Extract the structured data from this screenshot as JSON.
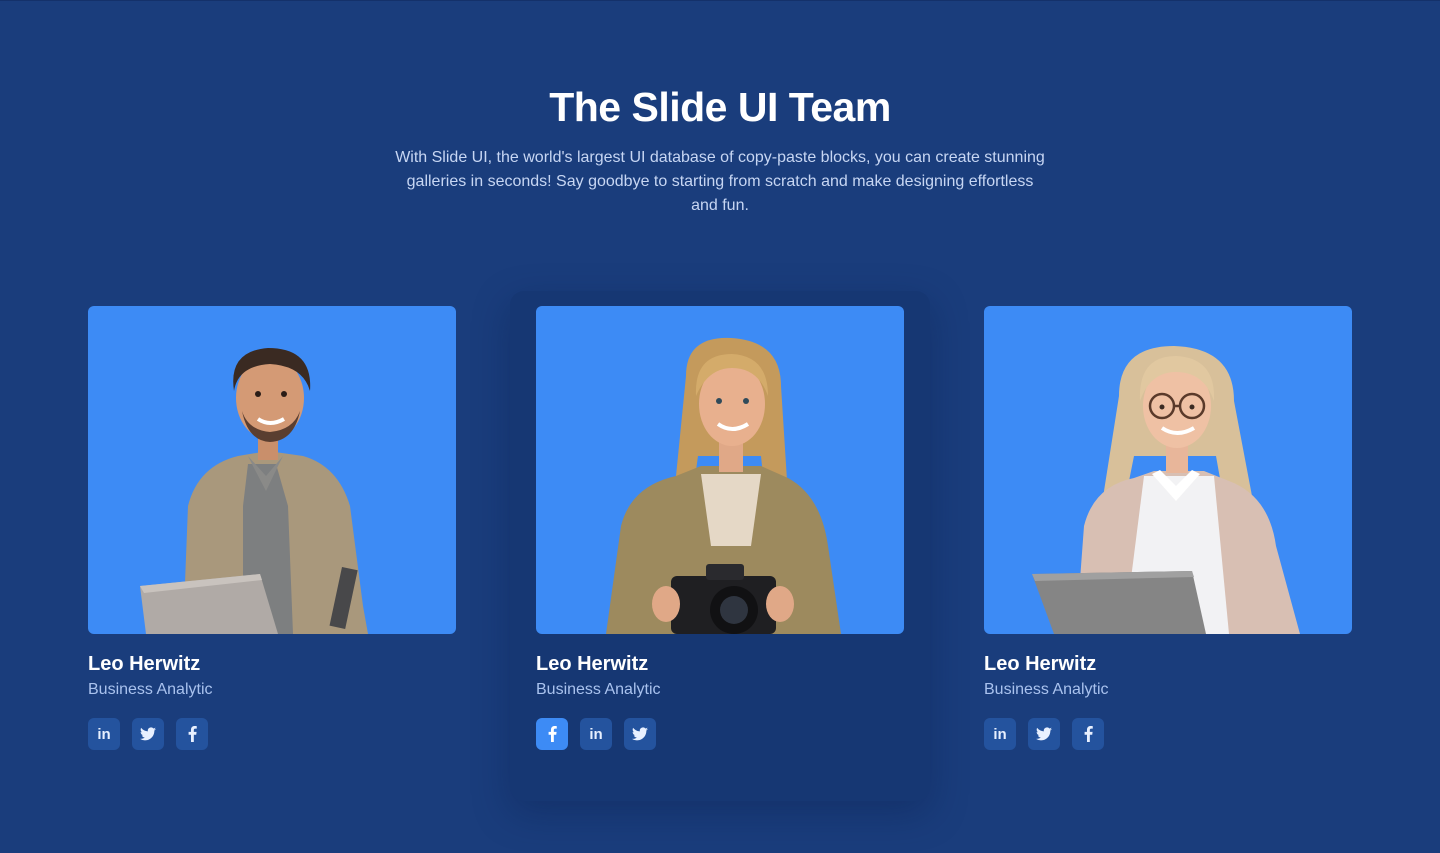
{
  "section": {
    "title": "The Slide UI Team",
    "description": "With Slide UI, the world's largest UI database of copy-paste blocks, you can create stunning galleries in seconds! Say goodbye to starting from scratch and make designing effortless and fun."
  },
  "colors": {
    "background": "#1a3d7c",
    "photo_background": "#3d8bf5",
    "social_button": "#24539e",
    "social_button_active": "#3d8bf5"
  },
  "team": [
    {
      "name": "Leo Herwitz",
      "role": "Business Analytic",
      "photo": "man-with-laptop",
      "socials": [
        {
          "icon": "linkedin-icon",
          "label": "in",
          "active": false
        },
        {
          "icon": "twitter-icon",
          "label": "",
          "active": false
        },
        {
          "icon": "facebook-icon",
          "label": "",
          "active": false
        }
      ]
    },
    {
      "name": "Leo Herwitz",
      "role": "Business Analytic",
      "photo": "woman-with-camera",
      "socials": [
        {
          "icon": "facebook-icon",
          "label": "",
          "active": true
        },
        {
          "icon": "linkedin-icon",
          "label": "in",
          "active": false
        },
        {
          "icon": "twitter-icon",
          "label": "",
          "active": false
        }
      ]
    },
    {
      "name": "Leo Herwitz",
      "role": "Business Analytic",
      "photo": "woman-with-glasses-and-laptop",
      "socials": [
        {
          "icon": "linkedin-icon",
          "label": "in",
          "active": false
        },
        {
          "icon": "twitter-icon",
          "label": "",
          "active": false
        },
        {
          "icon": "facebook-icon",
          "label": "",
          "active": false
        }
      ]
    }
  ]
}
